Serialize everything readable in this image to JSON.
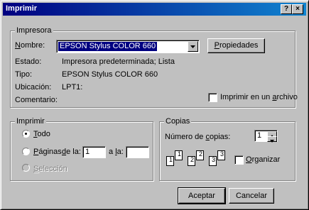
{
  "window": {
    "title": "Imprimir",
    "help": "?",
    "close": "×"
  },
  "printer": {
    "group_label": "Impresora",
    "name_label": "Nombre:",
    "name_value": "EPSON Stylus COLOR 660",
    "properties_button": "Propiedades",
    "status_label": "Estado:",
    "status_value": "Impresora predeterminada; Lista",
    "type_label": "Tipo:",
    "type_value": "EPSON Stylus COLOR 660",
    "location_label": "Ubicación:",
    "location_value": "LPT1:",
    "comment_label": "Comentario:",
    "print_to_file": "Imprimir en un archivo",
    "print_to_file_checked": false
  },
  "range": {
    "group_label": "Imprimir",
    "all": "Todo",
    "pages": "Páginas",
    "from_label": "de la:",
    "from_value": "1",
    "to_label": "a la:",
    "to_value": "",
    "selection": "Selección",
    "selected": "all"
  },
  "copies": {
    "group_label": "Copias",
    "count_label": "Número de copias:",
    "count_value": "1",
    "collate": "Organizar",
    "collate_checked": false,
    "page_numbers": [
      "1",
      "1",
      "2",
      "2",
      "3",
      "3"
    ]
  },
  "buttons": {
    "ok": "Aceptar",
    "cancel": "Cancelar"
  }
}
